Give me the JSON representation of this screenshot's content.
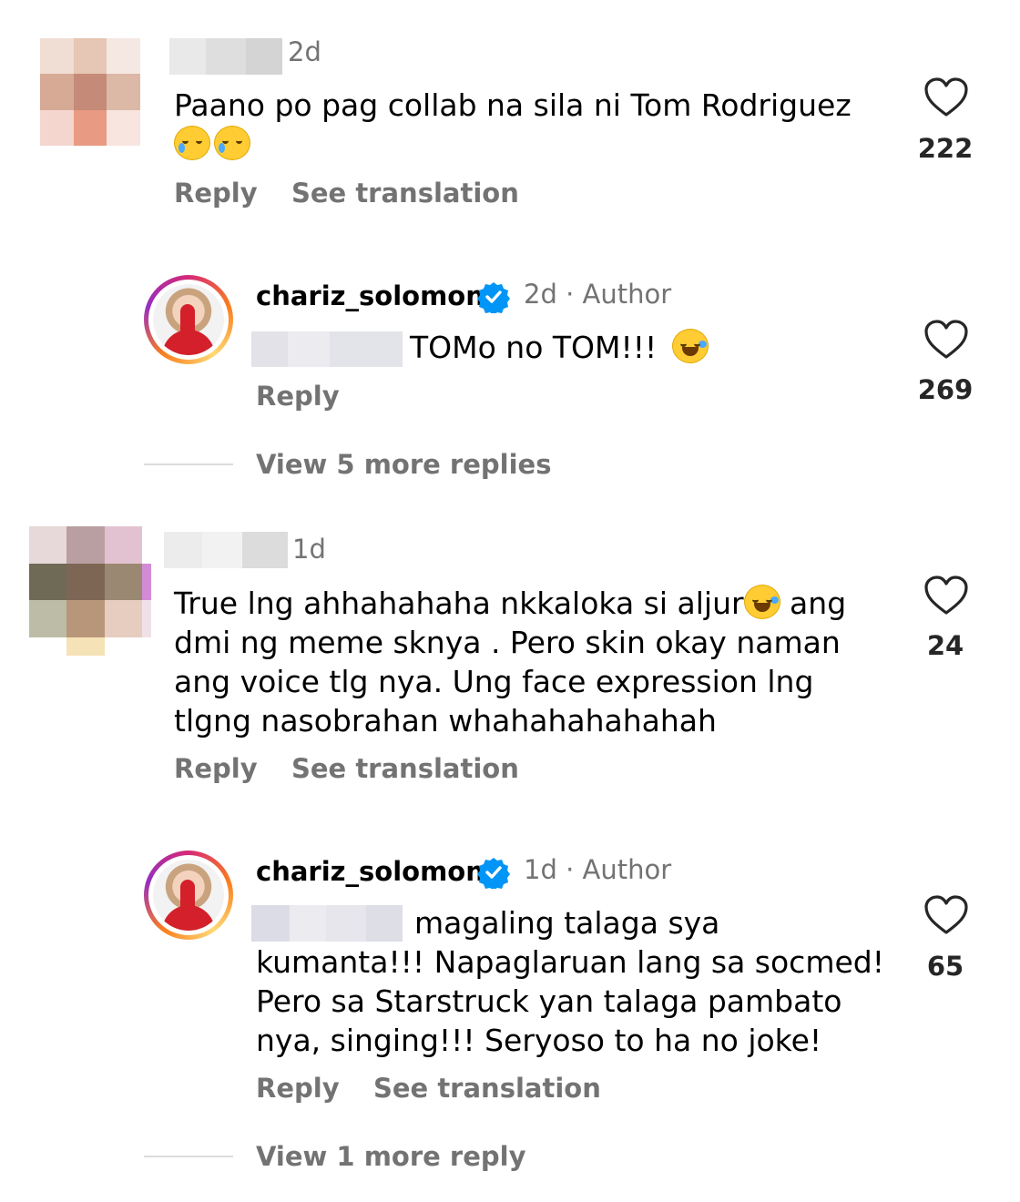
{
  "colors": {
    "muted": "#737373",
    "verified": "#0095f6",
    "text": "#000000",
    "divider": "#dbdbdb"
  },
  "comments": [
    {
      "time": "2d",
      "text": "Paano po pag collab na sila ni Tom Rodriguez",
      "emoji": [
        "crying-face-emoji",
        "crying-face-emoji"
      ],
      "likes": "222",
      "reply_label": "Reply",
      "translation_label": "See translation",
      "reply": {
        "username": "chariz_solomon",
        "time": "2d",
        "role": "Author",
        "text": "TOMo no TOM!!!",
        "emoji": "face-with-tears-of-joy-emoji",
        "likes": "269",
        "reply_label": "Reply"
      },
      "view_more": "View 5 more replies"
    },
    {
      "time": "1d",
      "text_lines": [
        "True lng ahhahahaha nkkaloka si aljur",
        " ang",
        "dmi ng meme sknya . Pero skin okay naman",
        "ang voice tlg nya. Ung face expression lng",
        "tlgng nasobrahan whahahahahahah"
      ],
      "likes": "24",
      "reply_label": "Reply",
      "translation_label": "See translation",
      "reply": {
        "username": "chariz_solomon",
        "time": "1d",
        "role": "Author",
        "text_lines": [
          "magaling talaga sya",
          "kumanta!!! Napaglaruan lang sa socmed!",
          "Pero sa Starstruck yan talaga pambato",
          "nya, singing!!! Seryoso to ha no joke!"
        ],
        "likes": "65",
        "reply_label": "Reply",
        "translation_label": "See translation"
      },
      "view_more": "View 1 more reply"
    }
  ]
}
